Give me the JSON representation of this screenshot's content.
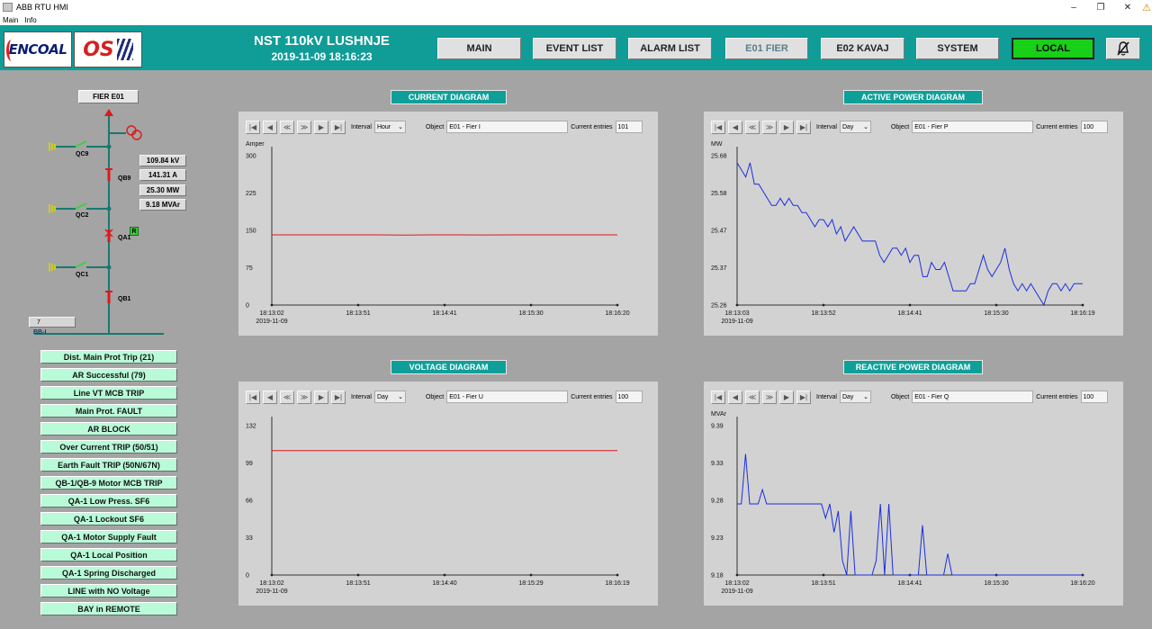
{
  "window": {
    "title": "ABB RTU HMI",
    "menu": [
      "Main",
      "Info"
    ],
    "controls": [
      "–",
      "❐",
      "✕"
    ]
  },
  "header": {
    "logo1": "ENCOAL",
    "logo2": "OS",
    "station": "NST 110kV LUSHNJE",
    "datetime": "2019-11-09 18:16:23",
    "nav": [
      "MAIN",
      "EVENT LIST",
      "ALARM LIST",
      "E01 FIER",
      "E02 KAVAJ",
      "SYSTEM"
    ],
    "local_label": "LOCAL",
    "local_color": "#18d018",
    "mute_icon": "alarm-mute-icon"
  },
  "bay": {
    "name": "FIER E01",
    "measurements": [
      "109.84 kV",
      "141.31 A",
      "25.30 MW",
      "9.18 MVAr"
    ],
    "switches": [
      "QC9",
      "QB9",
      "QC2",
      "QA1",
      "QC1",
      "QB1"
    ],
    "remote_badge": "R",
    "busbar_value": "7",
    "busbar_label": "BB-I"
  },
  "alarms": [
    "Dist. Main Prot Trip (21)",
    "AR Successful (79)",
    "Line VT MCB TRIP",
    "Main Prot. FAULT",
    "AR BLOCK",
    "Over Current TRIP (50/51)",
    "Earth Fault TRIP (50N/67N)",
    "QB-1/QB-9 Motor MCB TRIP",
    "QA-1 Low Press. SF6",
    "QA-1 Lockout SF6",
    "QA-1 Motor Supply Fault",
    "QA-1 Local Position",
    "QA-1 Spring Discharged",
    "LINE with NO Voltage",
    "BAY in REMOTE"
  ],
  "toolbar_labels": {
    "interval": "Interval",
    "object": "Object",
    "current_entries": "Current entries",
    "buttons": [
      "|◀",
      "◀",
      "≪",
      "≫",
      "▶",
      "▶|"
    ]
  },
  "panels": [
    {
      "title": "CURRENT DIAGRAM",
      "interval": "Hour",
      "object": "E01 - Fier  I",
      "entries": "101",
      "unit": "Amper",
      "yticks": [
        "300",
        "225",
        "150",
        "75",
        "0"
      ],
      "xticks": [
        "18:13:02",
        "18:13:51",
        "18:14:41",
        "18:15:30",
        "18:16:20"
      ],
      "xdate": "2019-11-09"
    },
    {
      "title": "ACTIVE POWER DIAGRAM",
      "interval": "Day",
      "object": "E01 - Fier  P",
      "entries": "100",
      "unit": "MW",
      "yticks": [
        "25.68",
        "25.58",
        "25.47",
        "25.37",
        "25.26"
      ],
      "xticks": [
        "18:13:03",
        "18:13:52",
        "18:14:41",
        "18:15:30",
        "18:16:19"
      ],
      "xdate": "2019-11-09"
    },
    {
      "title": "VOLTAGE DIAGRAM",
      "interval": "Day",
      "object": "E01 - Fier  U",
      "entries": "100",
      "unit": "",
      "yticks": [
        "132",
        "99",
        "66",
        "33",
        "0"
      ],
      "xticks": [
        "18:13:02",
        "18:13:51",
        "18:14:40",
        "18:15:29",
        "18:16:19"
      ],
      "xdate": "2019-11-09"
    },
    {
      "title": "REACTIVE POWER DIAGRAM",
      "interval": "Day",
      "object": "E01 - Fier  Q",
      "entries": "100",
      "unit": "MVAr",
      "yticks": [
        "9.39",
        "9.33",
        "9.28",
        "9.23",
        "9.18"
      ],
      "xticks": [
        "18:13:02",
        "18:13:51",
        "18:14:41",
        "18:15:30",
        "18:16:20"
      ],
      "xdate": "2019-11-09"
    }
  ],
  "chart_data": [
    {
      "type": "line",
      "title": "CURRENT DIAGRAM",
      "ylabel": "Amper",
      "ylim": [
        0,
        300
      ],
      "color": "#e01818",
      "series": [
        {
          "values": [
            141,
            141,
            141,
            141,
            141,
            140.5,
            141,
            141,
            140.8,
            141,
            141,
            141,
            141,
            141
          ]
        }
      ]
    },
    {
      "type": "line",
      "title": "ACTIVE POWER DIAGRAM",
      "ylabel": "MW",
      "ylim": [
        25.26,
        25.68
      ],
      "color": "#1a2ee0",
      "series": [
        {
          "values": [
            25.66,
            25.64,
            25.62,
            25.66,
            25.6,
            25.6,
            25.58,
            25.56,
            25.54,
            25.54,
            25.56,
            25.54,
            25.56,
            25.54,
            25.54,
            25.52,
            25.52,
            25.5,
            25.48,
            25.5,
            25.5,
            25.48,
            25.5,
            25.46,
            25.48,
            25.44,
            25.46,
            25.48,
            25.46,
            25.44,
            25.44,
            25.44,
            25.44,
            25.4,
            25.38,
            25.4,
            25.42,
            25.42,
            25.4,
            25.42,
            25.38,
            25.4,
            25.4,
            25.34,
            25.34,
            25.38,
            25.36,
            25.36,
            25.38,
            25.34,
            25.3,
            25.3,
            25.3,
            25.3,
            25.32,
            25.32,
            25.36,
            25.4,
            25.36,
            25.34,
            25.36,
            25.38,
            25.42,
            25.36,
            25.32,
            25.3,
            25.32,
            25.3,
            25.32,
            25.3,
            25.28,
            25.26,
            25.3,
            25.32,
            25.32,
            25.3,
            25.32,
            25.3,
            25.32,
            25.32,
            25.32
          ]
        }
      ]
    },
    {
      "type": "line",
      "title": "VOLTAGE DIAGRAM",
      "ylim": [
        0,
        132
      ],
      "color": "#e01818",
      "series": [
        {
          "values": [
            110,
            110,
            110,
            110,
            110,
            110,
            110,
            110,
            110,
            110
          ]
        }
      ]
    },
    {
      "type": "line",
      "title": "REACTIVE POWER DIAGRAM",
      "ylabel": "MVAr",
      "ylim": [
        9.18,
        9.39
      ],
      "color": "#1a2ee0",
      "series": [
        {
          "values": [
            9.28,
            9.28,
            9.35,
            9.28,
            9.28,
            9.28,
            9.3,
            9.28,
            9.28,
            9.28,
            9.28,
            9.28,
            9.28,
            9.28,
            9.28,
            9.28,
            9.28,
            9.28,
            9.28,
            9.28,
            9.28,
            9.26,
            9.28,
            9.24,
            9.27,
            9.2,
            9.18,
            9.27,
            9.18,
            9.18,
            9.18,
            9.18,
            9.18,
            9.2,
            9.28,
            9.18,
            9.28,
            9.18,
            9.18,
            9.18,
            9.18,
            9.18,
            9.18,
            9.18,
            9.25,
            9.18,
            9.18,
            9.18,
            9.18,
            9.18,
            9.21,
            9.18,
            9.18,
            9.18,
            9.18,
            9.18,
            9.18,
            9.18,
            9.18,
            9.18,
            9.18,
            9.18,
            9.18,
            9.18,
            9.18,
            9.18,
            9.18,
            9.18,
            9.18,
            9.18,
            9.18,
            9.18,
            9.18,
            9.18,
            9.18,
            9.18,
            9.18,
            9.18,
            9.18,
            9.18,
            9.18,
            9.18,
            9.18
          ]
        }
      ]
    }
  ]
}
